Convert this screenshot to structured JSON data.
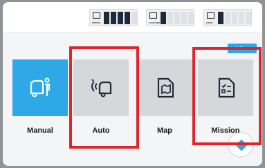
{
  "status": {
    "battery": {
      "label": "battery",
      "icon": "battery-icon",
      "level": 4,
      "max": 5
    },
    "coverage": {
      "label": "coverage",
      "icon": "coverage-icon",
      "level": 1,
      "max": 5
    },
    "clean": {
      "label": "clean",
      "icon": "clean-icon",
      "level": 1,
      "max": 5
    }
  },
  "menu": {
    "label": "Menu",
    "icon": "grid-icon"
  },
  "modes": [
    {
      "label": "Manual",
      "icon": "operator-machine-icon",
      "active": true
    },
    {
      "label": "Auto",
      "icon": "autonomous-machine-icon",
      "active": false
    },
    {
      "label": "Map",
      "icon": "map-icon",
      "active": false
    },
    {
      "label": "Mission",
      "icon": "checklist-icon",
      "active": false
    }
  ],
  "colors": {
    "accent": "#2ea8e6",
    "highlight": "#e0242b",
    "tile": "#d5d8db"
  }
}
